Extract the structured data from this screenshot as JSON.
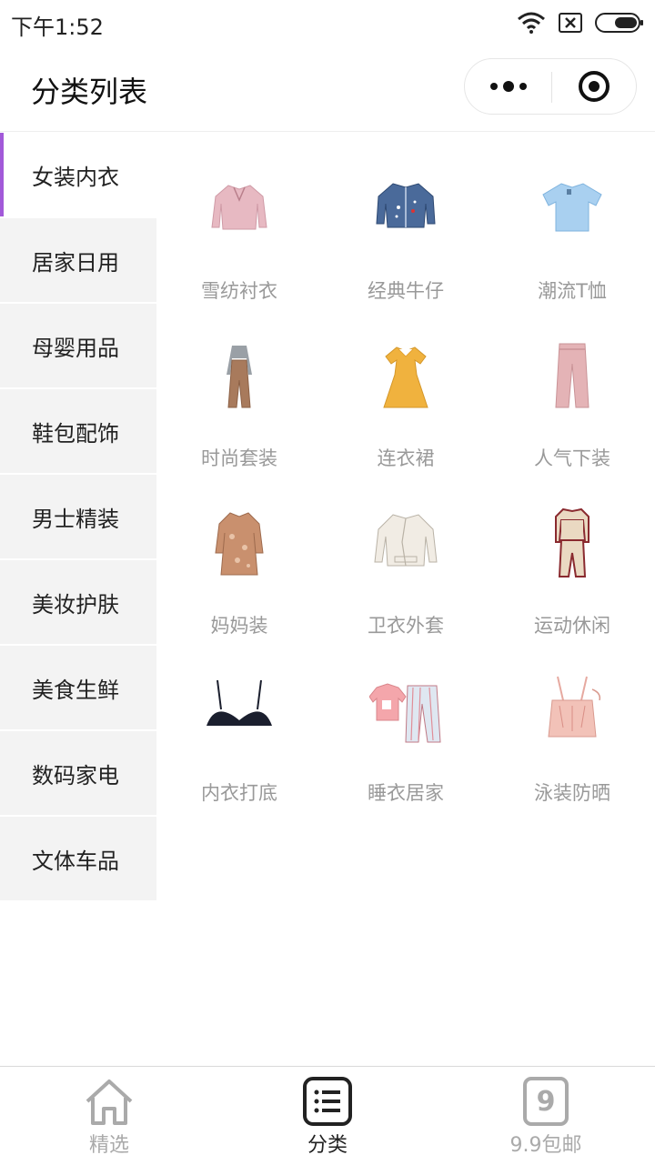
{
  "status": {
    "time": "下午1:52"
  },
  "header": {
    "title": "分类列表"
  },
  "colors": {
    "accent": "#a259d9",
    "sidebar_bg": "#f3f3f3",
    "label_gray": "#999999"
  },
  "sidebar": {
    "items": [
      {
        "label": "女装内衣",
        "active": true
      },
      {
        "label": "居家日用"
      },
      {
        "label": "母婴用品"
      },
      {
        "label": "鞋包配饰"
      },
      {
        "label": "男士精装"
      },
      {
        "label": "美妆护肤"
      },
      {
        "label": "美食生鲜"
      },
      {
        "label": "数码家电"
      },
      {
        "label": "文体车品"
      }
    ]
  },
  "subcategories": [
    {
      "label": "雪纺衬衣",
      "icon": "chiffon-blouse-image"
    },
    {
      "label": "经典牛仔",
      "icon": "denim-jacket-image"
    },
    {
      "label": "潮流T恤",
      "icon": "tshirt-image"
    },
    {
      "label": "时尚套装",
      "icon": "outfit-set-image"
    },
    {
      "label": "连衣裙",
      "icon": "dress-image"
    },
    {
      "label": "人气下装",
      "icon": "pants-image"
    },
    {
      "label": "妈妈装",
      "icon": "mother-dress-image"
    },
    {
      "label": "卫衣外套",
      "icon": "jacket-image"
    },
    {
      "label": "运动休闲",
      "icon": "tracksuit-image"
    },
    {
      "label": "内衣打底",
      "icon": "bra-image"
    },
    {
      "label": "睡衣居家",
      "icon": "pajamas-image"
    },
    {
      "label": "泳装防晒",
      "icon": "swimsuit-image"
    }
  ],
  "tabbar": {
    "tabs": [
      {
        "label": "精选",
        "icon": "home-icon",
        "active": false
      },
      {
        "label": "分类",
        "icon": "list-icon",
        "active": true
      },
      {
        "label": "9.9包邮",
        "icon": "nine-icon",
        "icon_text": "9",
        "active": false
      }
    ]
  }
}
